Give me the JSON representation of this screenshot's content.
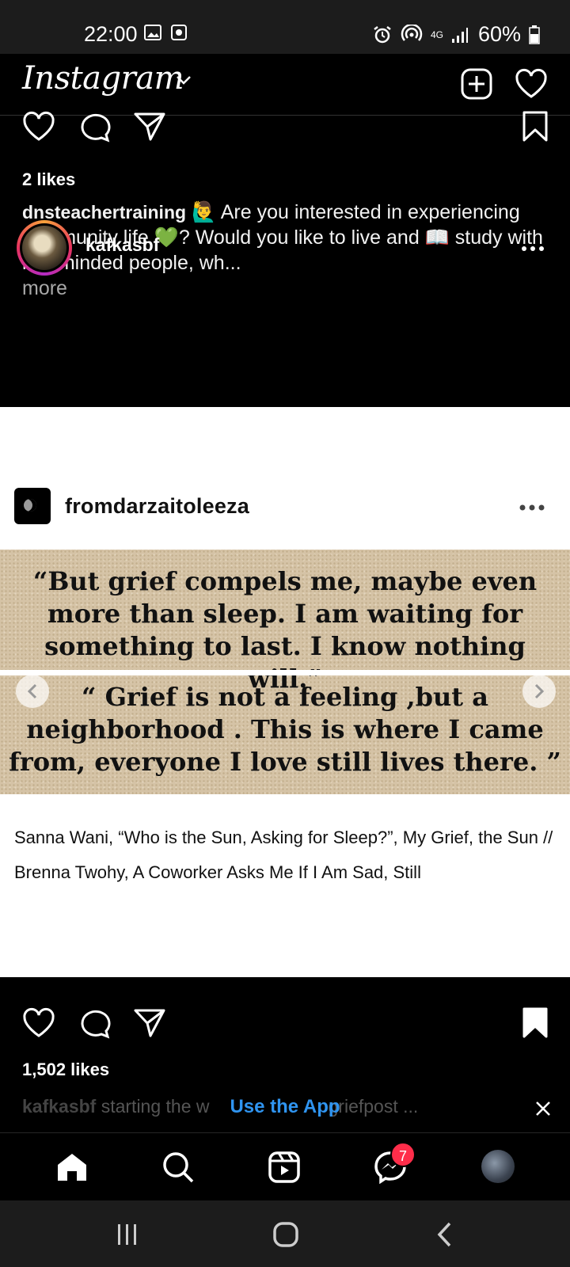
{
  "status_bar": {
    "time": "22:00",
    "network": "4G",
    "battery": "60%"
  },
  "header": {
    "logo": "Instagram"
  },
  "post1": {
    "likes": "2 likes",
    "caption_user": "dnsteachertraining",
    "caption_emoji_1": "🙋‍♂️",
    "caption_text_1": "Are you interested in experiencing community life",
    "caption_emoji_2": "💚",
    "caption_text_2": "? Would you like to live and",
    "caption_emoji_3": "📖",
    "caption_text_3": "study with like-minded people, wh...",
    "more": "more"
  },
  "next_post": {
    "username": "kafkasbf"
  },
  "embedded_card": {
    "username": "fromdarzaitoleeza",
    "quote_1": "“But grief compels me, maybe even more than sleep. I am waiting for something to last. I know nothing will.”",
    "quote_2": "“ Grief is not a feeling ,but a neighborhood . This is where I came from, everyone I love still lives there. ”",
    "caption": "Sanna Wani, “Who is the Sun, Asking for Sleep?”, My Grief, the Sun // Brenna Twohy, A Coworker Asks Me If I Am Sad, Still"
  },
  "post2": {
    "likes": "1,502 likes",
    "caption_user": "kafkasbf",
    "caption_text": "starting the w",
    "caption_tail": "griefpost ..."
  },
  "banner": {
    "use_app": "Use the App"
  },
  "bottom_nav": {
    "messages_badge": "7"
  },
  "colors": {
    "background": "#000000",
    "link_blue": "#2f94f0",
    "badge_red": "#ff2d4a",
    "quote_paper": "#d5c3a6"
  }
}
